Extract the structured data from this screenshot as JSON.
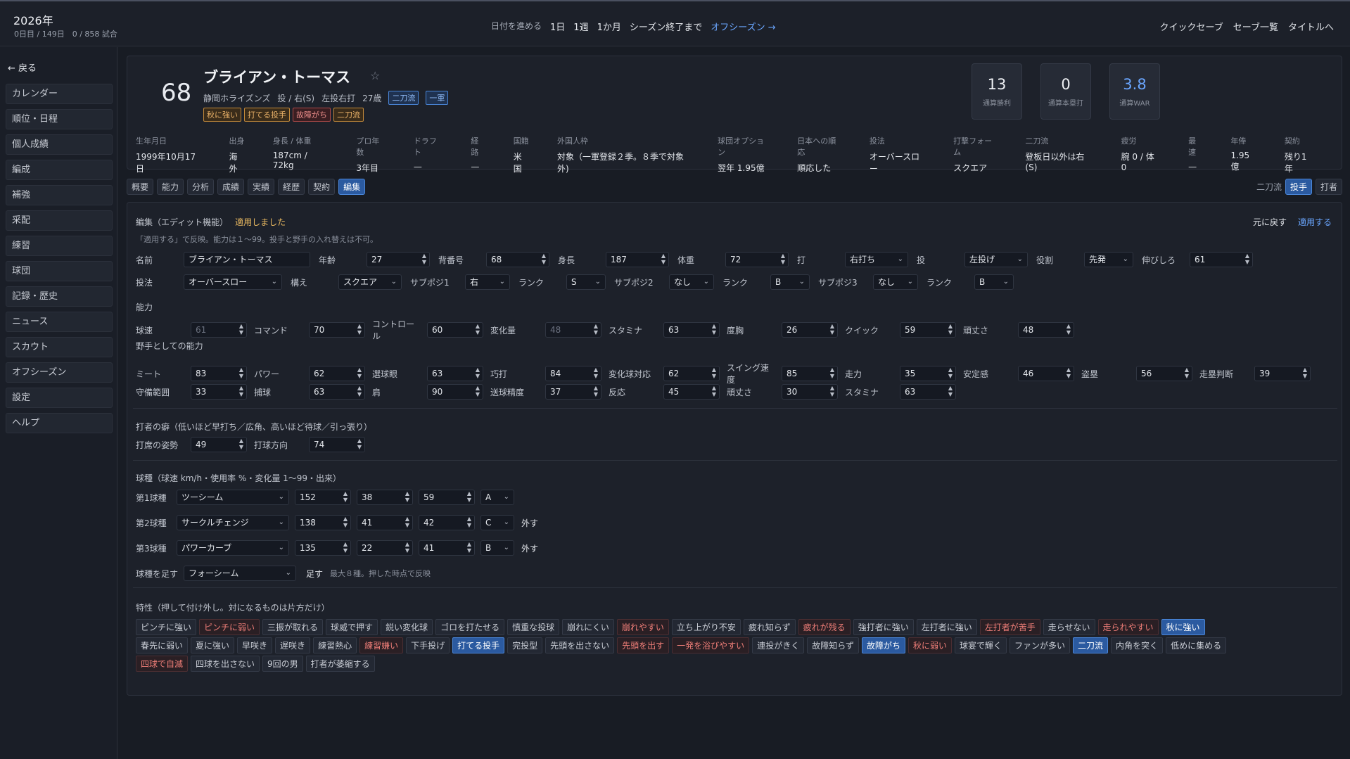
{
  "top": {
    "year": "2026年",
    "sub": "0日目 / 149日　0 / 858 試合",
    "adv_label": "日付を進める",
    "adv": [
      "1日",
      "1週",
      "1か月",
      "シーズン終了まで"
    ],
    "offseason": "オフシーズン →",
    "right": [
      "クイックセーブ",
      "セーブ一覧",
      "タイトルへ"
    ]
  },
  "sidebar": {
    "back": "← 戻る",
    "items": [
      "カレンダー",
      "順位・日程",
      "個人成績",
      "編成",
      "補強",
      "采配",
      "練習",
      "球団",
      "記録・歴史",
      "ニュース",
      "スカウト",
      "オフシーズン",
      "設定",
      "ヘルプ"
    ]
  },
  "player": {
    "number": "68",
    "name": "ブライアン・トーマス",
    "star": "☆",
    "team": "静岡ホライズンズ",
    "throws": "投 / 右(S)",
    "type": "左投右打",
    "age": "27歳",
    "badge1": "二刀流",
    "badge2": "一軍",
    "tags": [
      {
        "t": "秋に強い",
        "c": "o"
      },
      {
        "t": "打てる投手",
        "c": "o"
      },
      {
        "t": "故障がち",
        "c": "r"
      },
      {
        "t": "二刀流",
        "c": "o"
      }
    ],
    "stats": [
      {
        "v": "13",
        "l": "通算勝利"
      },
      {
        "v": "0",
        "l": "通算本塁打"
      },
      {
        "v": "3.8",
        "l": "通算WAR"
      }
    ],
    "info": [
      {
        "k": "生年月日",
        "v": "1999年10月17日"
      },
      {
        "k": "出身",
        "v": "海外"
      },
      {
        "k": "身長 / 体重",
        "v": "187cm / 72kg"
      },
      {
        "k": "プロ年数",
        "v": "3年目"
      },
      {
        "k": "ドラフト",
        "v": "—"
      },
      {
        "k": "経路",
        "v": "—"
      },
      {
        "k": "国籍",
        "v": "米国"
      },
      {
        "k": "外国人枠",
        "v": "対象（一軍登録２季。８季で対象外)"
      },
      {
        "k": "球団オプション",
        "v": "翌年 1.95億"
      },
      {
        "k": "日本への順応",
        "v": "順応した"
      },
      {
        "k": "投法",
        "v": "オーバースロー"
      },
      {
        "k": "打撃フォーム",
        "v": "スクエア"
      },
      {
        "k": "二刀流",
        "v": "登板日以外は右(S)"
      },
      {
        "k": "疲労",
        "v": "腕 0 / 体 0"
      },
      {
        "k": "最速",
        "v": "—"
      },
      {
        "k": "年俸",
        "v": "1.95億"
      },
      {
        "k": "契約",
        "v": "残り1年"
      }
    ]
  },
  "tabs": [
    "概要",
    "能力",
    "分析",
    "成績",
    "実績",
    "経歴",
    "契約",
    "編集"
  ],
  "mode": {
    "label": "二刀流",
    "pitcher": "投手",
    "batter": "打者"
  },
  "edit": {
    "title": "編集（エディット機能）",
    "applied": "適用しました",
    "note": "「適用する」で反映。能力は１〜99。投手と野手の入れ替えは不可。",
    "revert": "元に戻す",
    "apply": "適用する",
    "basic": {
      "name_l": "名前",
      "name": "ブライアン・トーマス",
      "age_l": "年齢",
      "age": "27",
      "num_l": "背番号",
      "num": "68",
      "h_l": "身長",
      "h": "187",
      "w_l": "体重",
      "w": "72",
      "bat_l": "打",
      "bat": "右打ち",
      "thr_l": "投",
      "thr": "左投げ",
      "role_l": "役割",
      "role": "先発",
      "grow_l": "伸びしろ",
      "grow": "61",
      "form_l": "投法",
      "form": "オーバースロー",
      "stance_l": "構え",
      "stance": "スクエア",
      "sub1_l": "サブポジ1",
      "sub1": "右",
      "rank1_l": "ランク",
      "rank1": "S",
      "sub2_l": "サブポジ2",
      "sub2": "なし",
      "rank2_l": "ランク",
      "rank2": "B",
      "sub3_l": "サブポジ3",
      "sub3": "なし",
      "rank3_l": "ランク",
      "rank3": "B"
    },
    "ability_title": "能力",
    "ability": [
      {
        "l": "球速",
        "v": "61",
        "dim": true
      },
      {
        "l": "コマンド",
        "v": "70"
      },
      {
        "l": "コントロール",
        "v": "60"
      },
      {
        "l": "変化量",
        "v": "48",
        "dim": true
      },
      {
        "l": "スタミナ",
        "v": "63"
      },
      {
        "l": "度胸",
        "v": "26"
      },
      {
        "l": "クイック",
        "v": "59"
      },
      {
        "l": "頑丈さ",
        "v": "48"
      }
    ],
    "fielder_title": "野手としての能力",
    "fielder1": [
      {
        "l": "ミート",
        "v": "83"
      },
      {
        "l": "パワー",
        "v": "62"
      },
      {
        "l": "選球眼",
        "v": "63"
      },
      {
        "l": "巧打",
        "v": "84"
      },
      {
        "l": "変化球対応",
        "v": "62"
      },
      {
        "l": "スイング速度",
        "v": "85"
      },
      {
        "l": "走力",
        "v": "35"
      },
      {
        "l": "安定感",
        "v": "46"
      },
      {
        "l": "盗塁",
        "v": "56"
      },
      {
        "l": "走塁判断",
        "v": "39"
      }
    ],
    "fielder2": [
      {
        "l": "守備範囲",
        "v": "33"
      },
      {
        "l": "捕球",
        "v": "63"
      },
      {
        "l": "肩",
        "v": "90"
      },
      {
        "l": "送球精度",
        "v": "37"
      },
      {
        "l": "反応",
        "v": "45"
      },
      {
        "l": "頑丈さ",
        "v": "30"
      },
      {
        "l": "スタミナ",
        "v": "63"
      }
    ],
    "habit_title": "打者の癖（低いほど早打ち／広角、高いほど待球／引っ張り）",
    "habit": [
      {
        "l": "打席の姿勢",
        "v": "49"
      },
      {
        "l": "打球方向",
        "v": "74"
      }
    ],
    "pitch_title": "球種（球速 km/h・使用率 %・変化量 1〜99・出来）",
    "pitches": [
      {
        "l": "第1球種",
        "name": "ツーシーム",
        "speed": "152",
        "use": "38",
        "brk": "59",
        "grade": "A",
        "rm": ""
      },
      {
        "l": "第2球種",
        "name": "サークルチェンジ",
        "speed": "138",
        "use": "41",
        "brk": "42",
        "grade": "C",
        "rm": "外す"
      },
      {
        "l": "第3球種",
        "name": "パワーカーブ",
        "speed": "135",
        "use": "22",
        "brk": "41",
        "grade": "B",
        "rm": "外す"
      }
    ],
    "addpitch": {
      "l": "球種を足す",
      "sel": "フォーシーム",
      "btn": "足す",
      "hint": "最大８種。押した時点で反映"
    },
    "traits_title": "特性（押して付け外し。対になるものは片方だけ）",
    "traits1": [
      {
        "t": "ピンチに強い",
        "c": "o"
      },
      {
        "t": "ピンチに弱い",
        "c": "r"
      },
      {
        "t": "三振が取れる",
        "c": "o"
      },
      {
        "t": "球威で押す",
        "c": "o"
      },
      {
        "t": "鋭い変化球",
        "c": "o"
      },
      {
        "t": "ゴロを打たせる",
        "c": "o"
      },
      {
        "t": "慎重な投球",
        "c": "n"
      },
      {
        "t": "崩れにくい",
        "c": "o"
      },
      {
        "t": "崩れやすい",
        "c": "r"
      },
      {
        "t": "立ち上がり不安",
        "c": "n"
      },
      {
        "t": "疲れ知らず",
        "c": "o"
      },
      {
        "t": "疲れが残る",
        "c": "r"
      },
      {
        "t": "強打者に強い",
        "c": "o"
      },
      {
        "t": "左打者に強い",
        "c": "o"
      },
      {
        "t": "左打者が苦手",
        "c": "r"
      },
      {
        "t": "走らせない",
        "c": "o"
      },
      {
        "t": "走られやすい",
        "c": "r"
      },
      {
        "t": "秋に強い",
        "c": "on"
      }
    ],
    "traits2": [
      {
        "t": "春先に弱い",
        "c": "n"
      },
      {
        "t": "夏に強い",
        "c": "n"
      },
      {
        "t": "早咲き",
        "c": "n"
      },
      {
        "t": "遅咲き",
        "c": "n"
      },
      {
        "t": "練習熱心",
        "c": "o"
      },
      {
        "t": "練習嫌い",
        "c": "r"
      },
      {
        "t": "下手投げ",
        "c": "n"
      },
      {
        "t": "打てる投手",
        "c": "on"
      },
      {
        "t": "完投型",
        "c": "o"
      },
      {
        "t": "先頭を出さない",
        "c": "o"
      },
      {
        "t": "先頭を出す",
        "c": "r"
      },
      {
        "t": "一発を浴びやすい",
        "c": "r"
      },
      {
        "t": "連投がきく",
        "c": "o"
      },
      {
        "t": "故障知らず",
        "c": "o"
      },
      {
        "t": "故障がち",
        "c": "on"
      },
      {
        "t": "秋に弱い",
        "c": "r"
      },
      {
        "t": "球宴で輝く",
        "c": "n"
      },
      {
        "t": "ファンが多い",
        "c": "n"
      },
      {
        "t": "二刀流",
        "c": "on"
      },
      {
        "t": "内角を突く",
        "c": "n"
      },
      {
        "t": "低めに集める",
        "c": "n"
      }
    ],
    "traits3": [
      {
        "t": "四球で自滅",
        "c": "r"
      },
      {
        "t": "四球を出さない",
        "c": "o"
      },
      {
        "t": "9回の男",
        "c": "o"
      },
      {
        "t": "打者が萎縮する",
        "c": "o"
      }
    ]
  }
}
